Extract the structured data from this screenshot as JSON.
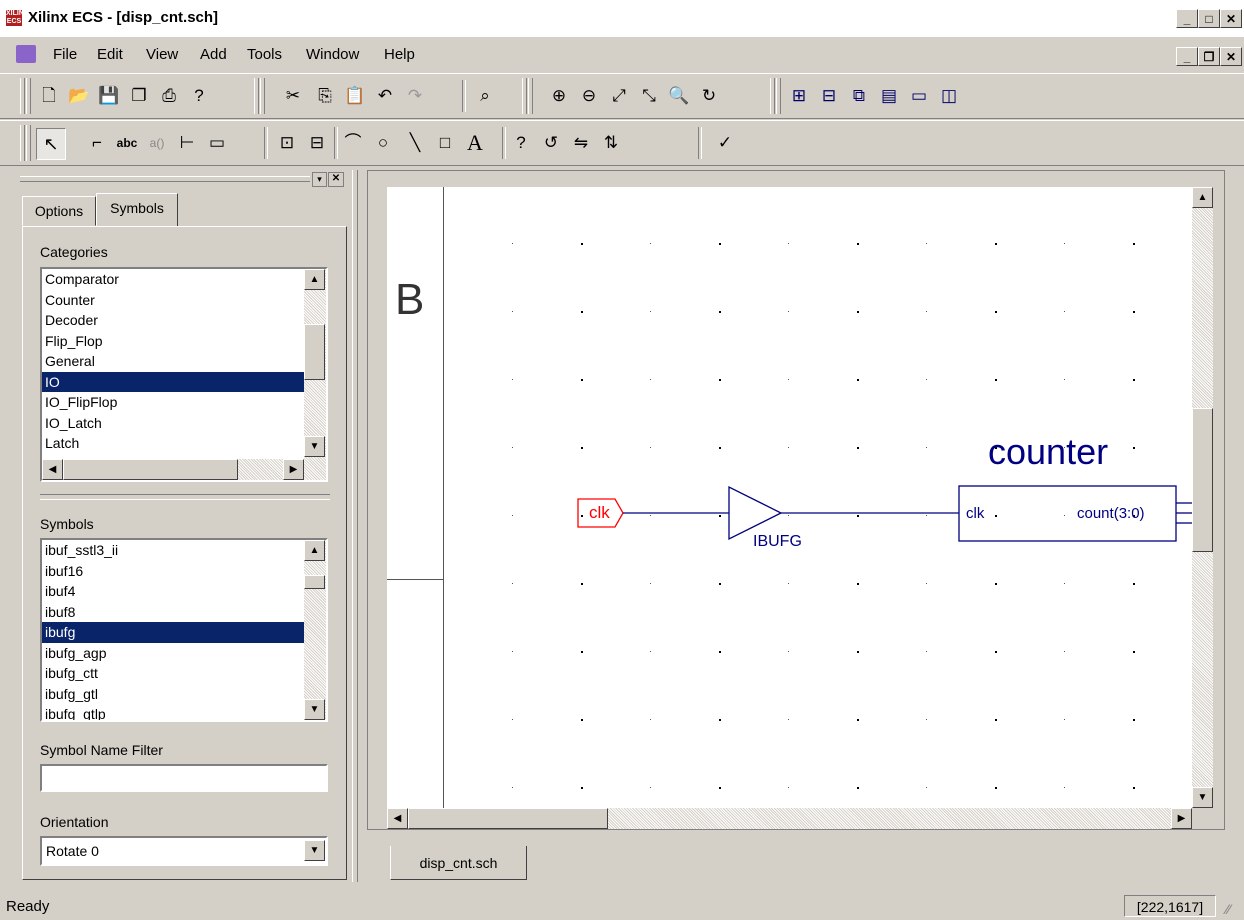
{
  "window": {
    "title": "Xilinx ECS - [disp_cnt.sch]",
    "app_icon_text": "XILINX ECS"
  },
  "menu": [
    "File",
    "Edit",
    "View",
    "Add",
    "Tools",
    "Window",
    "Help"
  ],
  "panel": {
    "tabs": [
      "Options",
      "Symbols"
    ],
    "active_tab": "Symbols",
    "categories_label": "Categories",
    "categories": [
      "Comparator",
      "Counter",
      "Decoder",
      "Flip_Flop",
      "General",
      "IO",
      "IO_FlipFlop",
      "IO_Latch",
      "Latch"
    ],
    "selected_category": "IO",
    "symbols_label": "Symbols",
    "symbols": [
      "ibuf_sstl3_ii",
      "ibuf16",
      "ibuf4",
      "ibuf8",
      "ibufg",
      "ibufg_agp",
      "ibufg_ctt",
      "ibufg_gtl",
      "ibufg_gtlp"
    ],
    "selected_symbol": "ibufg",
    "filter_label": "Symbol Name Filter",
    "filter_value": "",
    "orientation_label": "Orientation",
    "orientation_value": "Rotate 0"
  },
  "schematic": {
    "border_letter": "B",
    "port_label": "clk",
    "buffer_label": "IBUFG",
    "block_title": "counter",
    "block_input": "clk",
    "block_output": "count(3:0)",
    "tab": "disp_cnt.sch"
  },
  "status": {
    "text": "Ready",
    "coords": "[222,1617]"
  },
  "colors": {
    "wire": "#000080",
    "port": "#ff0000",
    "selection": "#0a246a"
  }
}
